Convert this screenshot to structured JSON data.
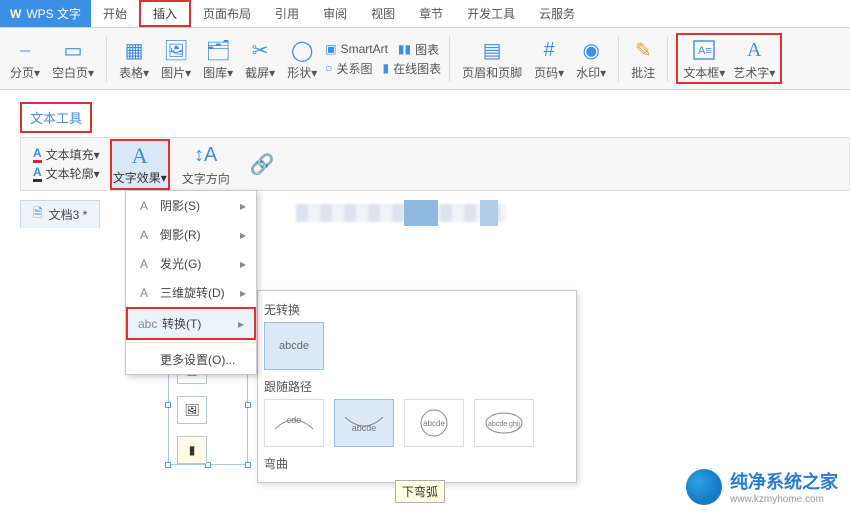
{
  "app": {
    "brand": "WPS 文字"
  },
  "tabs": {
    "start": "开始",
    "insert": "插入",
    "page_layout": "页面布局",
    "references": "引用",
    "review": "审阅",
    "view": "视图",
    "chapter": "章节",
    "developer": "开发工具",
    "cloud": "云服务"
  },
  "ribbon": {
    "page_break": "分页▾",
    "blank_page": "空白页▾",
    "table": "表格▾",
    "picture": "图片▾",
    "gallery": "图库▾",
    "screenshot": "截屏▾",
    "shapes": "形状▾",
    "relation": "关系图",
    "smartart": "SmartArt",
    "chart": "图表",
    "online_chart": "在线图表",
    "header_footer": "页眉和页脚",
    "page_number": "页码▾",
    "watermark": "水印▾",
    "comment": "批注",
    "text_box": "文本框▾",
    "wordart": "艺术字▾"
  },
  "context_tab": "文本工具",
  "text_tools": {
    "fill": "文本填充▾",
    "outline": "文本轮廓▾",
    "effects": "文字效果▾",
    "direction": "文字方向"
  },
  "doc_tab": "文档3 *",
  "effects_menu": {
    "shadow": "阴影(S)",
    "reflection": "倒影(R)",
    "glow": "发光(G)",
    "rotation3d": "三维旋转(D)",
    "transform": "转换(T)",
    "more": "更多设置(O)..."
  },
  "transform": {
    "no_transform": "无转换",
    "sample_text": "abcde",
    "follow_path": "跟随路径",
    "warp": "弯曲",
    "tooltip": "下弯弧",
    "path1": "cde",
    "path2": "abcde",
    "path3": "abcde",
    "path4": "abcde ghij"
  },
  "watermark_logo": {
    "title": "纯净系统之家",
    "url": "www.kzmyhome.com"
  }
}
